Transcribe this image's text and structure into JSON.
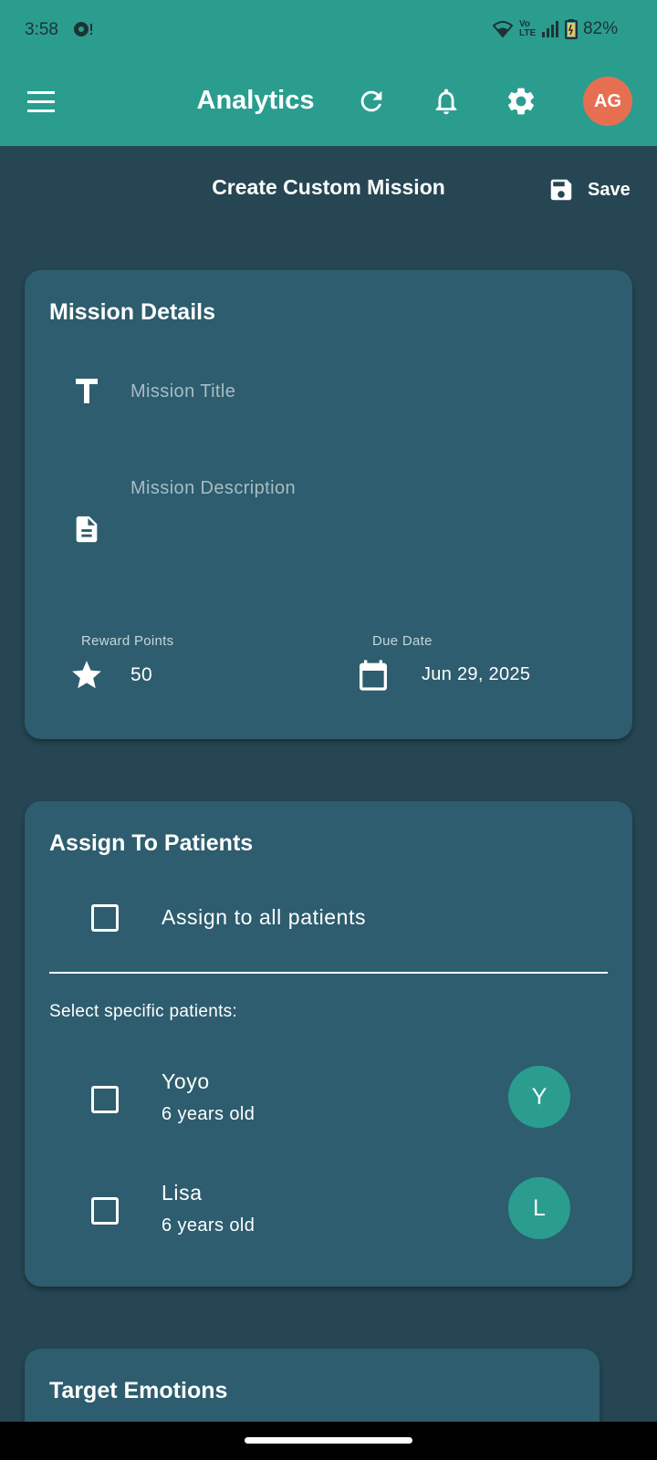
{
  "status_bar": {
    "time": "3:58",
    "network_label": "Vo LTE",
    "battery": "82%"
  },
  "app_bar": {
    "title": "Analytics",
    "avatar_initials": "AG",
    "avatar_color": "#e76f51",
    "icons": [
      "menu-icon",
      "refresh-icon",
      "bell-icon",
      "gear-icon"
    ]
  },
  "subheader": {
    "title": "Create Custom Mission",
    "save_label": "Save"
  },
  "mission_details": {
    "heading": "Mission Details",
    "title_placeholder": "Mission Title",
    "description_placeholder": "Mission Description",
    "reward_label": "Reward Points",
    "reward_value": "50",
    "due_label": "Due Date",
    "due_value": "Jun 29, 2025"
  },
  "assign": {
    "heading": "Assign To Patients",
    "all_label": "Assign to all patients",
    "all_checked": false,
    "specific_label": "Select specific patients:",
    "patients": [
      {
        "name": "Yoyo",
        "age": "6 years old",
        "initial": "Y",
        "checked": false
      },
      {
        "name": "Lisa",
        "age": "6 years old",
        "initial": "L",
        "checked": false
      }
    ]
  },
  "target_emotions": {
    "heading": "Target Emotions"
  },
  "colors": {
    "primary": "#2a9d8f",
    "background": "#264653",
    "card": "#2d5d6e",
    "accent": "#e76f51"
  }
}
